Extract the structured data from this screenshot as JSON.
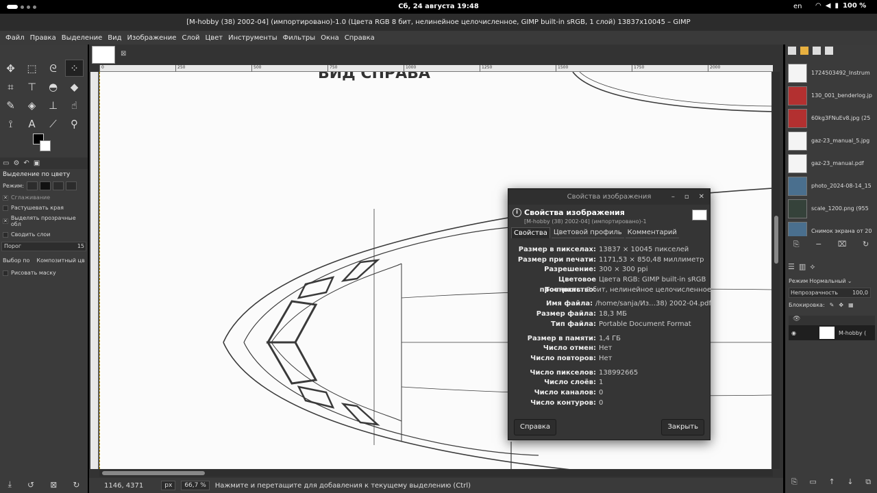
{
  "topbar": {
    "clock": "Сб, 24 августа  19:48",
    "lang": "en",
    "battery": "100 %"
  },
  "window": {
    "title": "[M-hobby (38) 2002-04] (импортировано)-1.0 (Цвета RGB 8 бит, нелинейное целочисленное, GIMP built-in sRGB, 1 слой) 13837x10045 – GIMP"
  },
  "menu": [
    "Файл",
    "Правка",
    "Выделение",
    "Вид",
    "Изображение",
    "Слой",
    "Цвет",
    "Инструменты",
    "Фильтры",
    "Окна",
    "Справка"
  ],
  "toolbox": {
    "tools": [
      {
        "name": "move-tool-icon",
        "glyph": "✥"
      },
      {
        "name": "rect-select-tool-icon",
        "glyph": "⬚"
      },
      {
        "name": "lasso-tool-icon",
        "glyph": "ᘓ"
      },
      {
        "name": "fuzzy-select-tool-icon",
        "glyph": "⁘"
      },
      {
        "name": "crop-tool-icon",
        "glyph": "⌗"
      },
      {
        "name": "transform-tool-icon",
        "glyph": "⊤"
      },
      {
        "name": "warp-tool-icon",
        "glyph": "◓"
      },
      {
        "name": "bucket-fill-tool-icon",
        "glyph": "◆"
      },
      {
        "name": "pencil-tool-icon",
        "glyph": "✎"
      },
      {
        "name": "eraser-tool-icon",
        "glyph": "◈"
      },
      {
        "name": "clone-tool-icon",
        "glyph": "⊥"
      },
      {
        "name": "smudge-tool-icon",
        "glyph": "☝"
      },
      {
        "name": "paths-tool-icon",
        "glyph": "⟟"
      },
      {
        "name": "text-tool-icon",
        "glyph": "A"
      },
      {
        "name": "color-picker-tool-icon",
        "glyph": "⟋"
      },
      {
        "name": "zoom-tool-icon",
        "glyph": "⚲"
      }
    ],
    "options_title": "Выделение по цвету",
    "mode_label": "Режим:",
    "antialias": "Сглаживание",
    "feather": "Растушевать края",
    "select_transparent": "Выделять прозрачные обл",
    "sample_merged": "Сводить слои",
    "threshold_label": "Порог",
    "threshold_value": "15",
    "select_by_label": "Выбор по",
    "select_by_value": "Композитный цв",
    "draw_mask": "Рисовать маску"
  },
  "canvas": {
    "ruler_ticks": [
      "0",
      "250",
      "500",
      "750",
      "1000",
      "1250",
      "1500",
      "1750",
      "2000"
    ],
    "heading_text": "ВИД СПРАВА"
  },
  "status": {
    "coords": "1146, 4371",
    "unit": "px",
    "zoom": "66,7 %",
    "message": "Нажмите и перетащите для добавления к текущему выделению (Ctrl)"
  },
  "documents": [
    {
      "name": "1724503492_Instrum",
      "thumb": "doc"
    },
    {
      "name": "130_001_benderlog.jp",
      "thumb": "red"
    },
    {
      "name": "60kg3FNuEv8.jpg (25",
      "thumb": "red"
    },
    {
      "name": "gaz-23_manual_5.jpg",
      "thumb": "doc"
    },
    {
      "name": "gaz-23_manual.pdf",
      "thumb": "doc"
    },
    {
      "name": "photo_2024-08-14_15",
      "thumb": "photo"
    },
    {
      "name": "scale_1200.png (955",
      "thumb": "dark"
    },
    {
      "name": "Снимок экрана от 20",
      "thumb": "photo"
    }
  ],
  "layers": {
    "mode_label": "Режим",
    "mode_value": "Нормальный",
    "opacity_label": "Непрозрачность",
    "opacity_value": "100,0",
    "lock_label": "Блокировка:",
    "layer_name": "M-hobby ("
  },
  "dialog": {
    "window_title": "Свойства изображения",
    "heading": "Свойства изображения",
    "subheading": "[M-hobby (38) 2002-04] (импортировано)-1",
    "tabs": [
      "Свойства",
      "Цветовой профиль",
      "Комментарий"
    ],
    "rows": [
      {
        "k": "Размер в пикселах:",
        "v": "13837 × 10045 пикселей"
      },
      {
        "k": "Размер при печати:",
        "v": "1171,53 × 850,48 миллиметр"
      },
      {
        "k": "Разрешение:",
        "v": "300 × 300 ppi"
      },
      {
        "k": "Цветовое пространство:",
        "v": "Цвета RGB: GIMP built-in sRGB"
      },
      {
        "k": "Точность:",
        "v": "8 бит, нелинейное целочисленное"
      },
      {
        "gap": true
      },
      {
        "k": "Имя файла:",
        "v": "/home/sanja/Из…38) 2002-04.pdf"
      },
      {
        "k": "Размер файла:",
        "v": "18,3 МБ"
      },
      {
        "k": "Тип файла:",
        "v": "Portable Document Format"
      },
      {
        "gap": true
      },
      {
        "k": "Размер в памяти:",
        "v": "1,4 ГБ"
      },
      {
        "k": "Число отмен:",
        "v": "Нет"
      },
      {
        "k": "Число повторов:",
        "v": "Нет"
      },
      {
        "gap": true
      },
      {
        "k": "Число пикселов:",
        "v": "138992665"
      },
      {
        "k": "Число слоёв:",
        "v": "1"
      },
      {
        "k": "Число каналов:",
        "v": "0"
      },
      {
        "k": "Число контуров:",
        "v": "0"
      }
    ],
    "help_button": "Справка",
    "close_button": "Закрыть"
  }
}
